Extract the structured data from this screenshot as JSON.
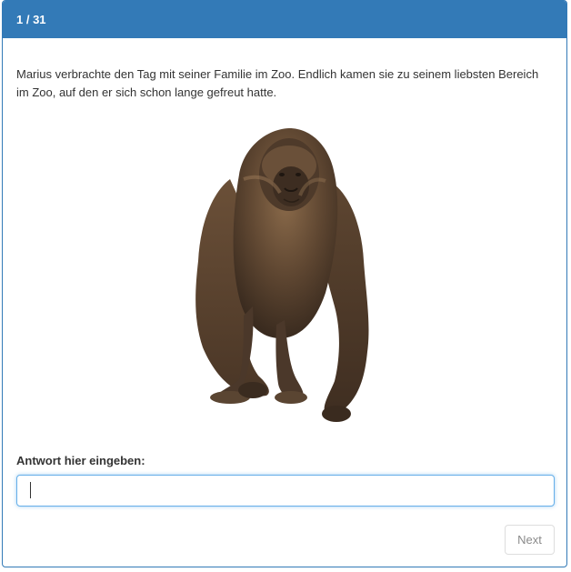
{
  "header": {
    "progress": "1 / 31",
    "accent_color": "#337ab7"
  },
  "question": {
    "text": "Marius verbrachte den Tag mit seiner Familie im Zoo. Endlich kamen sie zu seinem liebsten Bereich im Zoo, auf den er sich schon lange gefreut hatte.",
    "image": "gorilla"
  },
  "answer": {
    "label": "Antwort hier eingeben:",
    "value": "",
    "placeholder": ""
  },
  "footer": {
    "next_label": "Next"
  }
}
